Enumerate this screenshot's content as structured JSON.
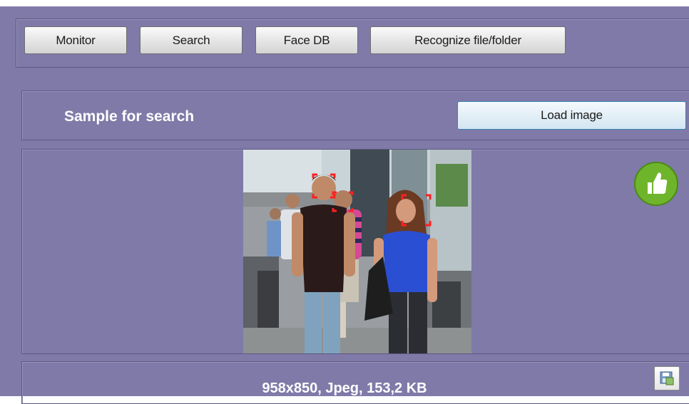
{
  "toolbar": {
    "buttons": [
      "Monitor",
      "Search",
      "Face DB",
      "Recognize file/folder"
    ]
  },
  "sample_panel": {
    "title": "Sample for search",
    "load_button": "Load image"
  },
  "image_panel": {
    "info": "958x850, Jpeg, 153,2 KB",
    "status_icon": "thumbs-up-icon",
    "save_icon": "save-image-icon"
  },
  "colors": {
    "background": "#7f7aa8",
    "border": "#5c5880",
    "status_ok": "#6fb52c",
    "face_marker": "#ff2020"
  }
}
